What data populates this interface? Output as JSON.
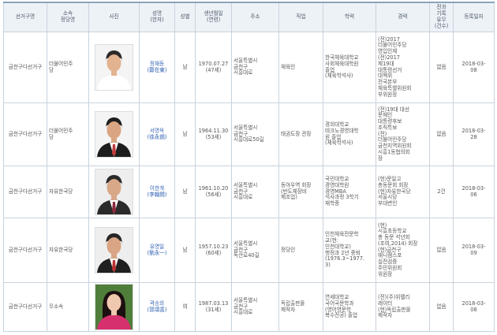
{
  "headers": {
    "district": "선거구명",
    "party": "소속\n정당명",
    "photo": "사진",
    "name": "성명\n(한자)",
    "gender": "성별",
    "birth": "생년월일\n(연령)",
    "address": "주소",
    "job": "직업",
    "education": "학력",
    "career": "경력",
    "record": "전과\n기록\n유무\n(건수)",
    "regdate": "등록일자"
  },
  "rows": [
    {
      "district": "금천구다선거구",
      "party": "더불어민주\n당",
      "name": "정재동\n(鄭在東)",
      "gender": "남",
      "birth": "1970.07.27\n(47세)",
      "address": "서울특별시\n금천구\n시흥대로",
      "job": "체육인",
      "education": "한국체육대학교\n사회체육대학원\n졸업\n(체육학석사)",
      "career": "(전)2017\n더불어민주당\n영입인재\n(전)2017\n제19대\n대통령선거\n대책위\n전국본부\n체육특별위원회\n부위원장",
      "record": "없음",
      "regdate": "2018-03-\n08",
      "photo_colors": {
        "bg": "#f4f4f4",
        "hair": "#2a2a2a",
        "face": "#e3b28f",
        "suit": "#ffffff",
        "shirt": "#ffffff",
        "tie": "#ffffff"
      }
    },
    {
      "district": "금천구다선거구",
      "party": "더불어민주\n당",
      "name": "서명옥\n(徐永錫)",
      "gender": "남",
      "birth": "1964.11.30\n(53세)",
      "address": "서울특별시\n금천구\n시흥대로50길",
      "job": "태권도장 관장",
      "education": "경희대학교\n테크노경영대학\n원 졸업\n(체육학석사)",
      "career": "(전)19대 대선\n문재인\n대통령후보\n조직특보\n(전)\n더불어민주당\n금천지역위원회\n시흥1동협의회\n장",
      "record": "없음",
      "regdate": "2018-03-\n28",
      "photo_colors": {
        "bg": "#f4f4f4",
        "hair": "#1e1e1e",
        "face": "#d9a582",
        "suit": "#1d1d1d",
        "shirt": "#ffffff",
        "tie": "#c23a3a"
      }
    },
    {
      "district": "금천구다선거구",
      "party": "자유한국당",
      "name": "이한개\n(李翰開)",
      "gender": "남",
      "birth": "1961.10.20\n(56세)",
      "address": "서울특별시\n금천구\n시흥대로",
      "job": "동아우역 회장\n(반도체장비\n제조업)",
      "education": "국민대학교\n경영대학원\n경영MBA\n석사과정 3학기\n재학중",
      "career": "(현)문일고\n총동문회 회장\n(현)자유한국당\n서울시당\n부대변인",
      "record": "2건",
      "regdate": "2018-03-\n06",
      "photo_colors": {
        "bg": "#eeeeee",
        "hair": "#2a2a2a",
        "face": "#d8a888",
        "suit": "#2a2a2a",
        "shirt": "#ffffff",
        "tie": "#8a2a3a"
      }
    },
    {
      "district": "금천구다선거구",
      "party": "자유한국당",
      "name": "유영일\n(劉永一)",
      "gender": "남",
      "birth": "1957.10.23\n(60세)",
      "address": "서울특별시\n금천구\n독산로40길",
      "job": "정당인",
      "education": "인천체육전문학\n교(현:\n인천대학교)\n행정과 2년 중퇴\n(1976.3~1977.\n3)",
      "career": "(현)\n시흥초등학교\n총 동문 석년회\n(조여,2014) 회장\n(현)금천구\n애니캠스포\n실전검증\n주민위원회\n위원장",
      "record": "없음",
      "regdate": "2018-03-\n09",
      "photo_colors": {
        "bg": "#eeeeee",
        "hair": "#262626",
        "face": "#d9a584",
        "suit": "#202020",
        "shirt": "#ffffff",
        "tie": "#b8322f"
      }
    },
    {
      "district": "금천구다선거구",
      "party": "무소속",
      "name": "곽송희\n(郭頌喜)",
      "gender": "여",
      "birth": "1987.03.13\n(31세)",
      "address": "서울특별시\n금천구\n시흥대로",
      "job": "독립출판물\n제작자",
      "education": "연세대학교\n국어국문학과\n(영어영문학\n복수전공) 졸업",
      "career": "(전)(주)위펠리\n레이터\n(현)독립출판물\n제작자",
      "record": "없음",
      "regdate": "2018-03-\n08",
      "photo_colors": {
        "bg": "#4f7e3b",
        "hair": "#1c1010",
        "face": "#f0c8b0",
        "suit": "#d6306e",
        "shirt": "#d6306e",
        "tie": "#d6306e"
      }
    }
  ]
}
